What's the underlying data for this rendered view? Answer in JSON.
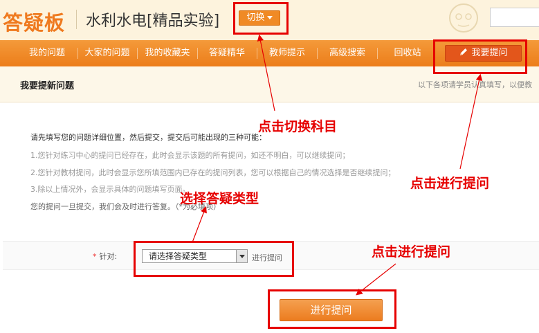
{
  "header": {
    "logo": "答疑板",
    "course_title": "水利水电[精品实验]",
    "switch_label": "切换"
  },
  "nav": {
    "items": [
      "我的问题",
      "大家的问题",
      "我的收藏夹",
      "答疑精华",
      "教师提示",
      "高级搜索",
      "回收站"
    ],
    "ask_button": "我要提问"
  },
  "section": {
    "title": "我要提新问题",
    "hint": "以下各项请学员认真填写，以便教"
  },
  "instructions": {
    "intro": "请先填写您的问题详细位置，然后提交，提交后可能出现的三种可能：",
    "rules": [
      "1.您针对练习中心的提问已经存在，此时会显示该题的所有提问，如还不明白，可以继续提问；",
      "2.您针对教材提问，此时会显示您所填范围内已存在的提问列表，您可以根据自己的情况选择是否继续提问；",
      "3.除以上情况外，会显示具体的问题填写页面。"
    ],
    "note": "您的提问一旦提交，我们会及时进行答复。（*为必填项）"
  },
  "form": {
    "label": "针对:",
    "required_mark": "*",
    "select_value": "请选择答疑类型",
    "after_select": "进行提问",
    "submit": "进行提问"
  },
  "annotations": {
    "switch_subject": "点击切换科目",
    "ask_question": "点击进行提问",
    "select_type": "选择答疑类型",
    "submit_question": "点击进行提问"
  },
  "colors": {
    "brand_orange": "#ec7d1a",
    "annotation_red": "#e60000"
  }
}
